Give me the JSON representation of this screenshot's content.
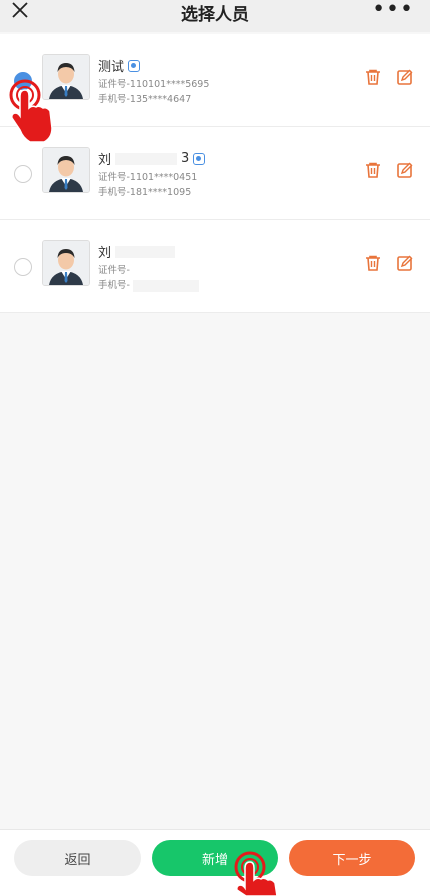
{
  "header": {
    "title": "选择人员",
    "close_icon": "close-icon",
    "more_icon": "more-icon"
  },
  "people": [
    {
      "name": "测试",
      "id_label": "证件号-110101****5695",
      "phone_label": "手机号-135****4647",
      "selected": true
    },
    {
      "name": "刘",
      "name_suffix": "3",
      "id_label": "证件号-1101****0451",
      "phone_label": "手机号-181****1095",
      "selected": false
    },
    {
      "name": "刘",
      "id_label": "证件号-",
      "phone_label": "手机号-",
      "selected": false
    }
  ],
  "footer": {
    "back_label": "返回",
    "add_label": "新增",
    "next_label": "下一步"
  },
  "colors": {
    "accent_blue": "#4a90e2",
    "add_green": "#17c66a",
    "next_orange": "#f36c38",
    "icon_orange": "#e8743b",
    "pointer_red": "#e31b1b"
  }
}
